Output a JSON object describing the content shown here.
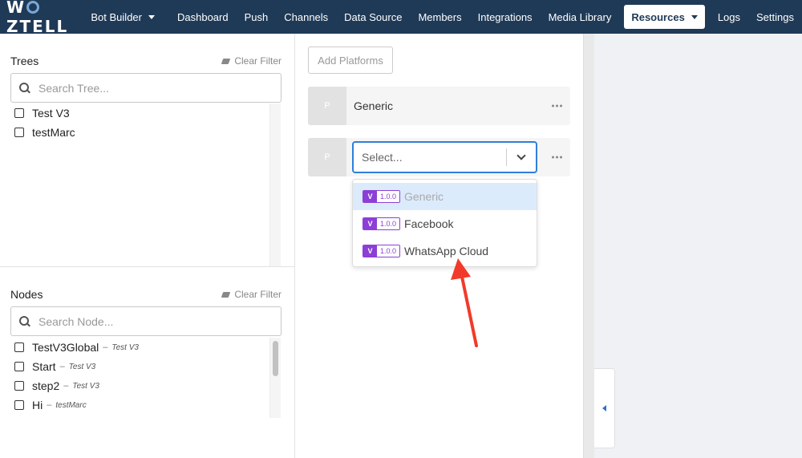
{
  "nav": {
    "logo": "WOZTELL",
    "items": [
      {
        "label": "Bot Builder",
        "dropdown": true
      },
      {
        "label": "Dashboard"
      },
      {
        "label": "Push"
      },
      {
        "label": "Channels"
      },
      {
        "label": "Data Source"
      },
      {
        "label": "Members"
      },
      {
        "label": "Integrations"
      },
      {
        "label": "Media Library"
      },
      {
        "label": "Resources",
        "dropdown": true,
        "active": true
      },
      {
        "label": "Logs"
      },
      {
        "label": "Settings"
      }
    ]
  },
  "trees": {
    "title": "Trees",
    "clear_filter": "Clear Filter",
    "search_placeholder": "Search Tree...",
    "items": [
      "Test V3",
      "testMarc"
    ]
  },
  "nodes": {
    "title": "Nodes",
    "clear_filter": "Clear Filter",
    "search_placeholder": "Search Node...",
    "items": [
      {
        "name": "TestV3Global",
        "tree": "Test V3"
      },
      {
        "name": "Start",
        "tree": "Test V3"
      },
      {
        "name": "step2",
        "tree": "Test V3"
      },
      {
        "name": "Hi",
        "tree": "testMarc"
      }
    ]
  },
  "platforms": {
    "add_button": "Add Platforms",
    "badge": "P",
    "cards": [
      {
        "name": "Generic"
      }
    ],
    "select_placeholder": "Select...",
    "options": [
      {
        "badge": "V",
        "version": "1.0.0",
        "label": "Generic",
        "highlighted": true
      },
      {
        "badge": "V",
        "version": "1.0.0",
        "label": "Facebook"
      },
      {
        "badge": "V",
        "version": "1.0.0",
        "label": "WhatsApp Cloud"
      }
    ]
  },
  "colors": {
    "nav_bg": "#1f3a57",
    "focus_blue": "#2f7fdc",
    "version_purple": "#8b3fd6",
    "annotation_red": "#f23a2a"
  }
}
